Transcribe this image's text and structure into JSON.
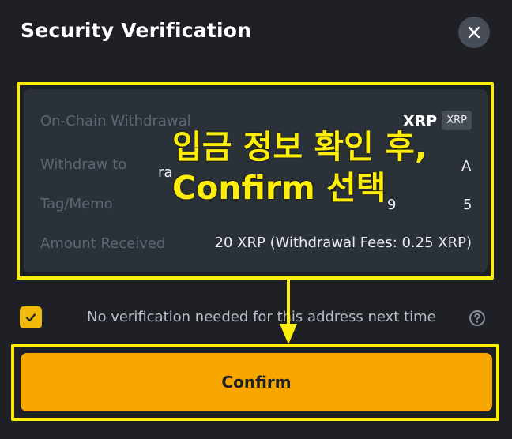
{
  "dialog": {
    "title": "Security Verification",
    "close_icon": "close-icon"
  },
  "details": {
    "chain": {
      "label": "On-Chain Withdrawal",
      "coin": "XRP",
      "coin_tag": "XRP"
    },
    "withdraw_to": {
      "label": "Withdraw to",
      "address_start": "ra",
      "address_end": "A"
    },
    "tag": {
      "label": "Tag/Memo",
      "value_start": "9",
      "value_end": "5"
    },
    "amount": {
      "label": "Amount Received",
      "value": "20 XRP (Withdrawal Fees: 0.25 XRP)"
    }
  },
  "annotation": {
    "line1": "입금 정보 확인 후,",
    "line2": "Confirm 선택",
    "color": "#fcee0a"
  },
  "remember": {
    "checked": true,
    "label": "No verification needed for this address next time",
    "help_icon": "question-circle-icon"
  },
  "confirm_button": {
    "label": "Confirm",
    "color": "#f7a600"
  }
}
